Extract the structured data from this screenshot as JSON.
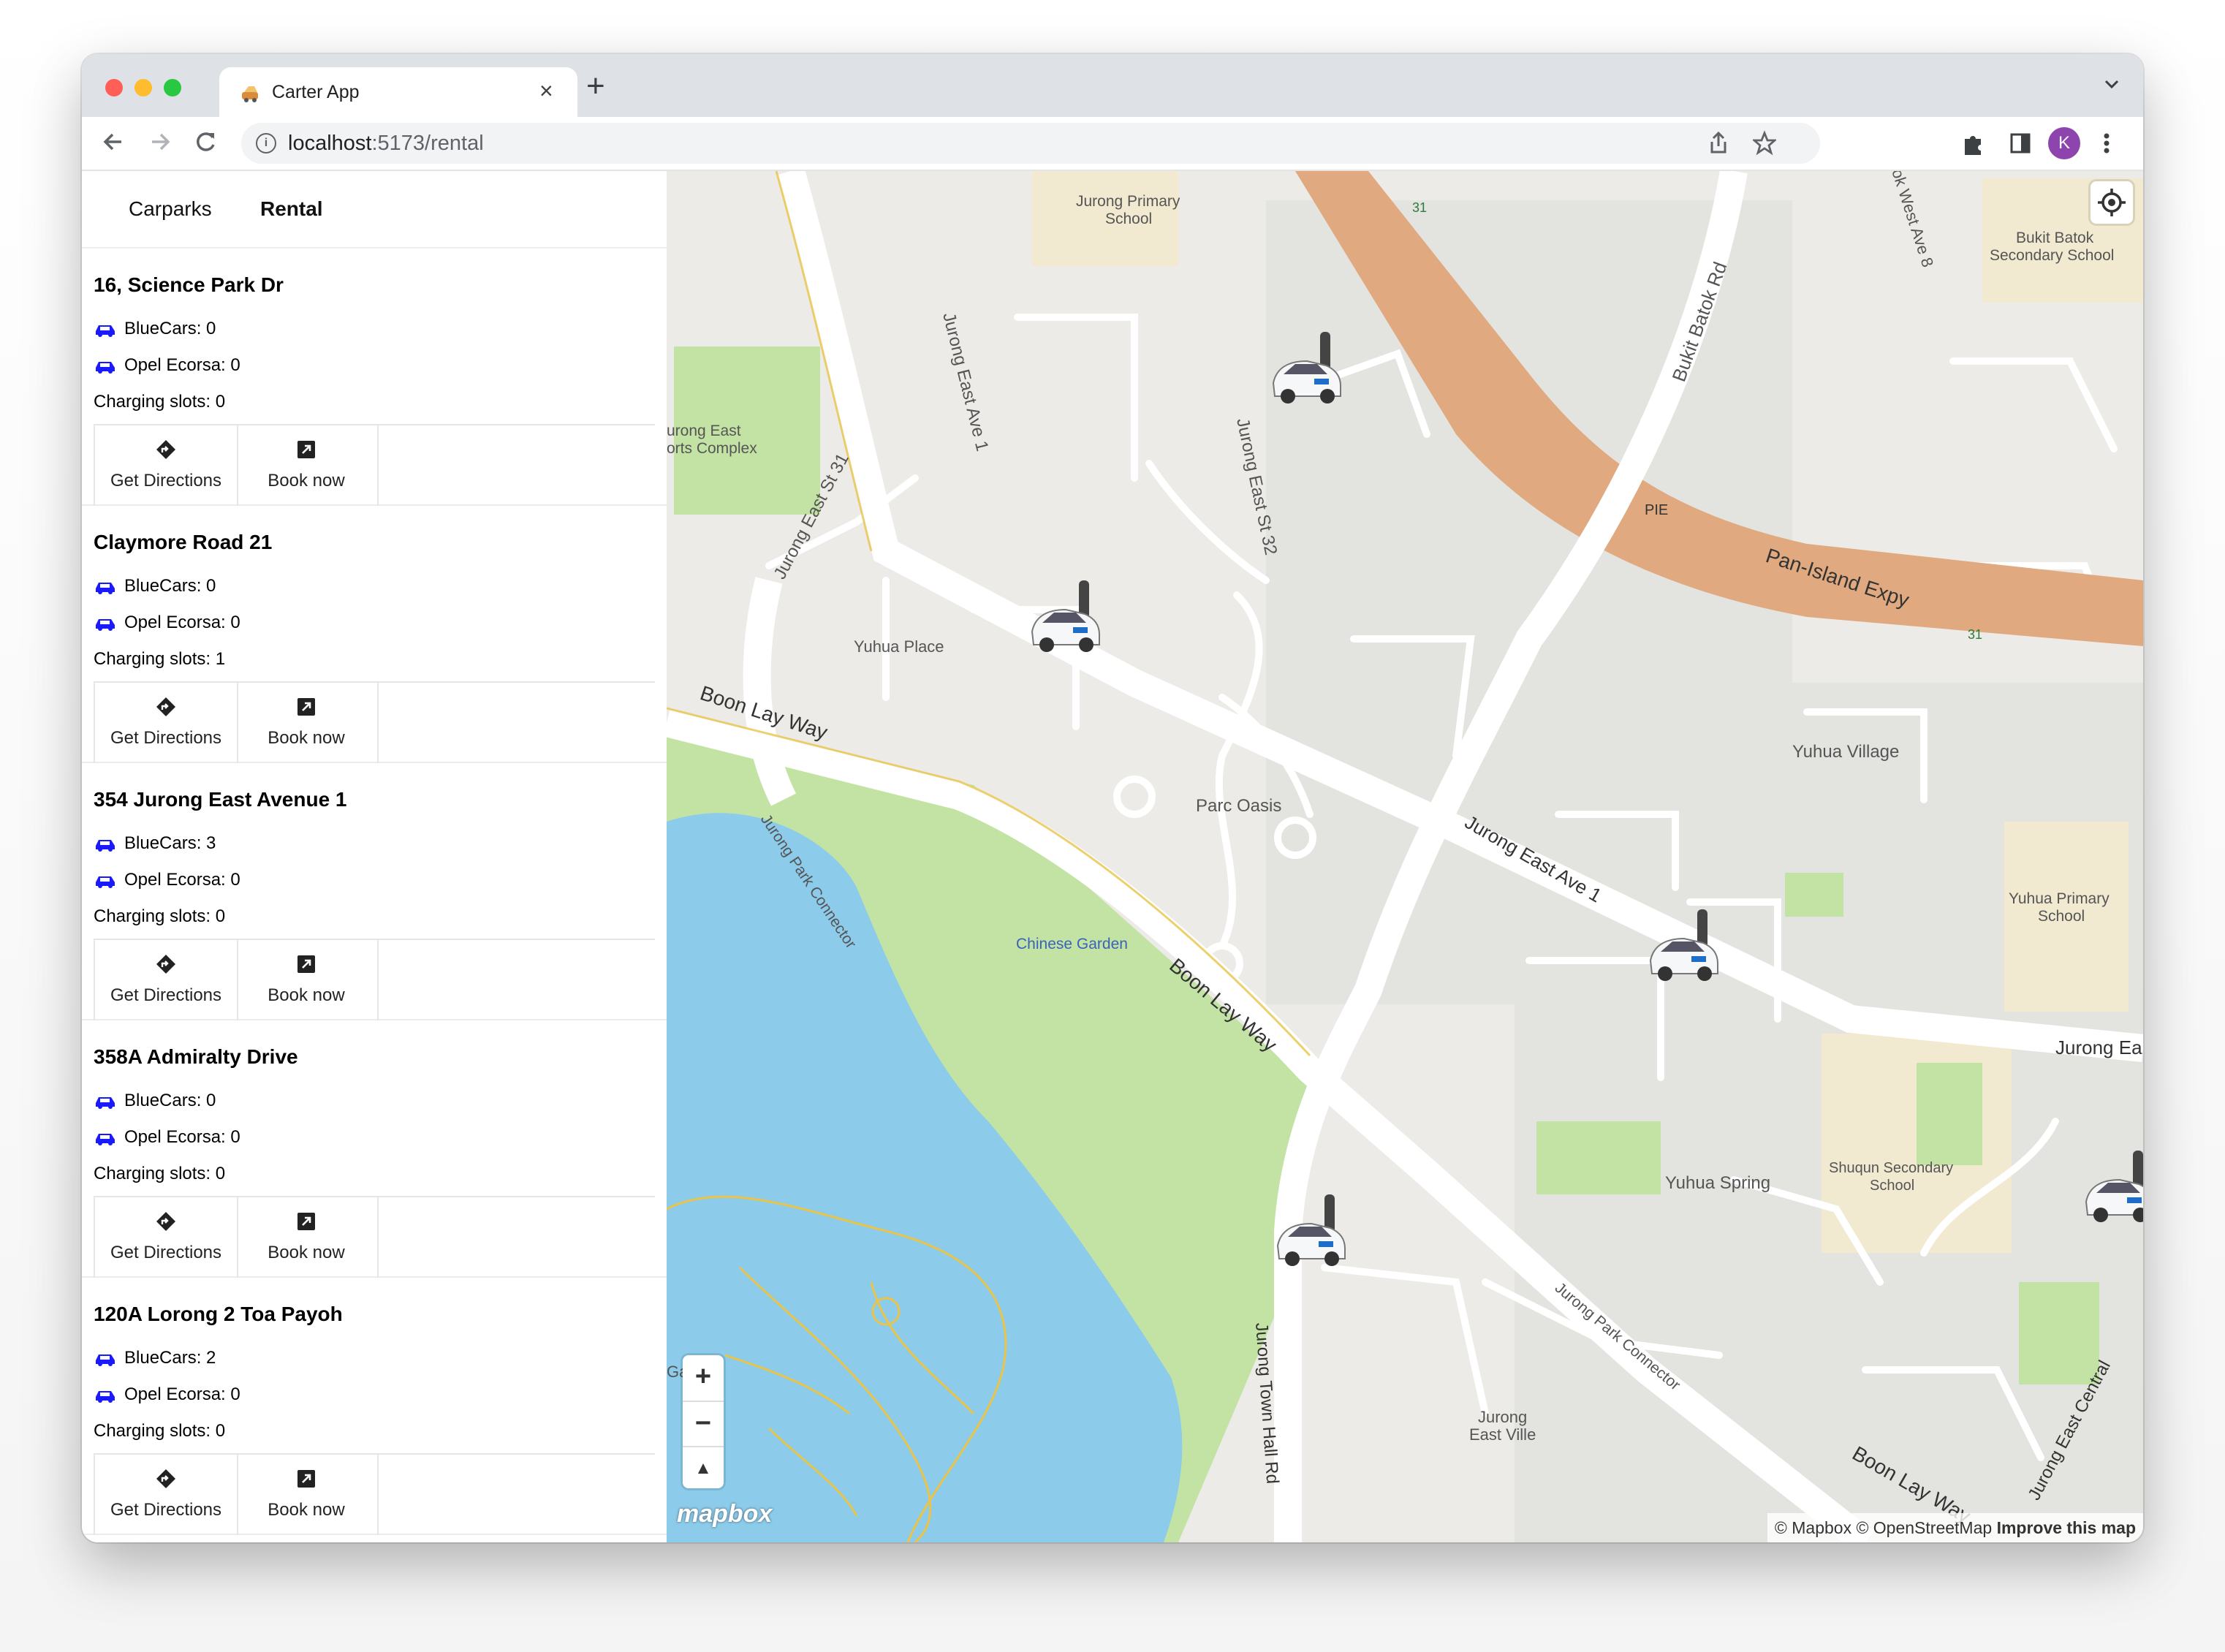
{
  "browser": {
    "tab_title": "Carter App",
    "tab_close": "×",
    "new_tab": "+",
    "url_host": "localhost",
    "url_path": ":5173/rental",
    "profile_initial": "K"
  },
  "nav": {
    "tabs": [
      {
        "label": "Carparks",
        "active": false
      },
      {
        "label": "Rental",
        "active": true
      }
    ]
  },
  "locations": [
    {
      "name": "16, Science Park Dr",
      "bluecars": "BlueCars: 0",
      "opel": "Opel Ecorsa: 0",
      "charging": "Charging slots: 0"
    },
    {
      "name": "Claymore Road 21",
      "bluecars": "BlueCars: 0",
      "opel": "Opel Ecorsa: 0",
      "charging": "Charging slots: 1"
    },
    {
      "name": "354 Jurong East Avenue 1",
      "bluecars": "BlueCars: 3",
      "opel": "Opel Ecorsa: 0",
      "charging": "Charging slots: 0"
    },
    {
      "name": "358A Admiralty Drive",
      "bluecars": "BlueCars: 0",
      "opel": "Opel Ecorsa: 0",
      "charging": "Charging slots: 0"
    },
    {
      "name": "120A Lorong 2 Toa Payoh",
      "bluecars": "BlueCars: 2",
      "opel": "Opel Ecorsa: 0",
      "charging": "Charging slots: 0"
    }
  ],
  "actions": {
    "directions_label": "Get Directions",
    "book_label": "Book now"
  },
  "map": {
    "labels": {
      "jurong_primary": "Jurong Primary",
      "jurong_primary_2": "School",
      "bukit_batok_sec": "Bukit Batok",
      "bukit_batok_sec_2": "Secondary School",
      "jurong_east_sports": "urong East",
      "jurong_east_sports_2": "orts Complex",
      "jurong_east_ave1_a": "Jurong East Ave 1",
      "jurong_east_st31": "Jurong East St 31",
      "jurong_east_st32": "Jurong East St 32",
      "bukit_batok_rd": "Bukit Batok Rd",
      "west_ave8": "ok West Ave 8",
      "pie": "PIE",
      "pan_island": "Pan-Island Expy",
      "exit31a": "31",
      "exit31b": "31",
      "yuhua_place": "Yuhua Place",
      "boon_lay_way_a": "Boon Lay Way",
      "boon_lay_way_b": "Boon Lay Way",
      "boon_lay_way_c": "Boon Lay Way",
      "parc_oasis": "Parc Oasis",
      "yuhua_village": "Yuhua Village",
      "jurong_east_ave1_b": "Jurong East Ave 1",
      "jurong_park_connector_a": "Jurong Park Connector",
      "jurong_park_connector_b": "Jurong Park Connector",
      "chinese_garden": "Chinese Garden",
      "yuhua_primary": "Yuhua Primary",
      "yuhua_primary_2": "School",
      "jurong_ea": "Jurong Ea",
      "yuhua_spring": "Yuhua Spring",
      "shuqun": "Shuqun Secondary",
      "shuqun_2": "School",
      "jurong_town_hall": "Jurong Town Hall Rd",
      "jurong_east_ville": "Jurong",
      "jurong_east_ville_2": "East Ville",
      "jurong_east_central": "Jurong East Central",
      "garden_partial": "Ga"
    },
    "zoom_in": "+",
    "zoom_out": "−",
    "compass": "▲",
    "logo": "mapbox",
    "attribution": "© Mapbox © OpenStreetMap",
    "improve": "Improve this map"
  },
  "colors": {
    "car_icon": "#1a1aff",
    "water": "#8ccbea",
    "park": "#c3e3a5",
    "highway": "#e0a97f",
    "road": "#ffffff",
    "minor_road": "#e8c44a"
  }
}
